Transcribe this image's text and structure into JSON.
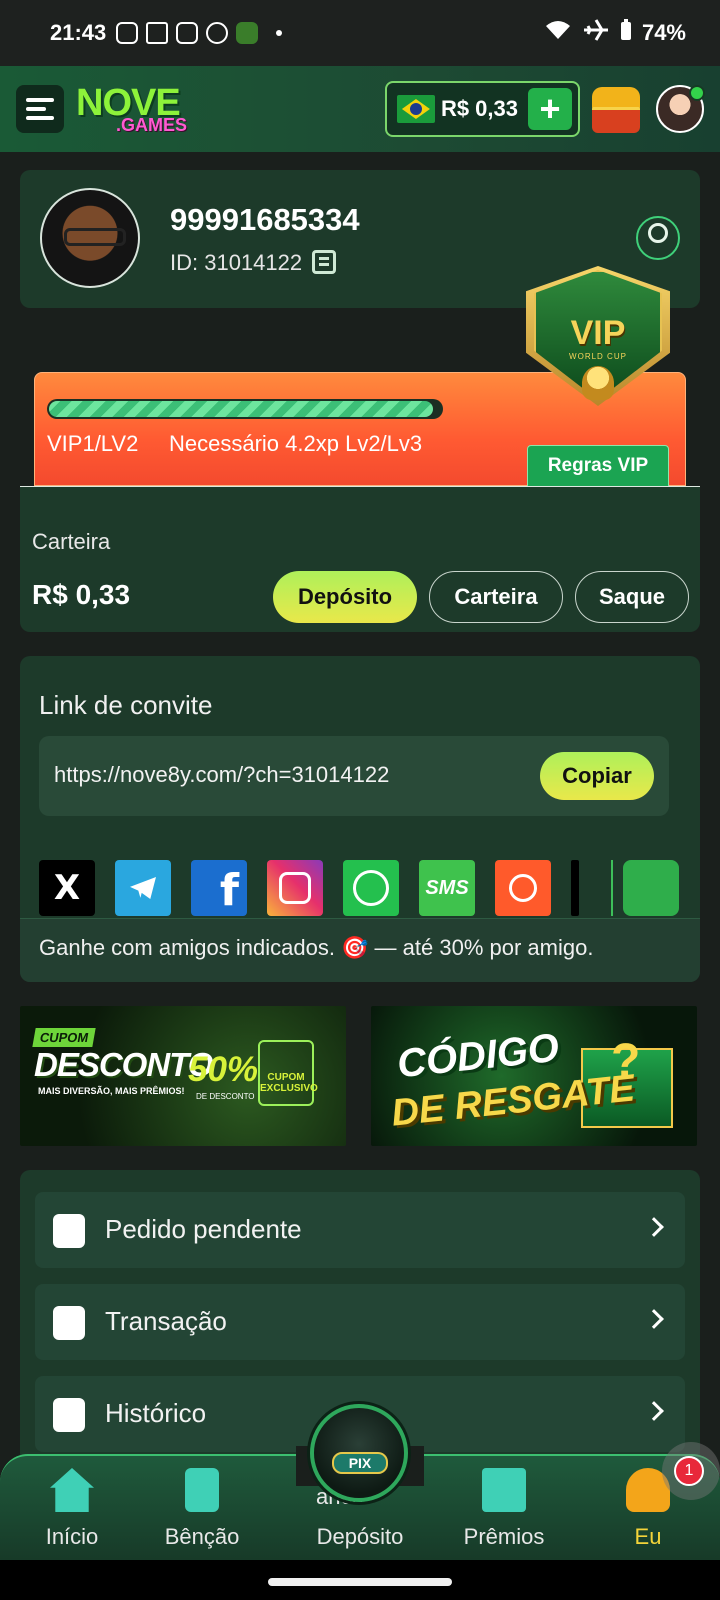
{
  "status_bar": {
    "time": "21:43",
    "battery": "74%"
  },
  "header": {
    "logo_top": "NOVE",
    "logo_bottom": ".GAMES",
    "balance": "R$ 0,33",
    "add_label": "+"
  },
  "profile": {
    "username": "99991685334",
    "id_text": "ID: 31014122"
  },
  "vip": {
    "badge": "VIP",
    "badge_sub": "WORLD CUP",
    "progress": 0.98,
    "level": "VIP1/LV2",
    "need": "Necessário 4.2xp Lv2/Lv3",
    "rules_label": "Regras VIP"
  },
  "wallet": {
    "title": "Carteira",
    "amount": "R$ 0,33",
    "deposit_label": "Depósito",
    "wallet_label": "Carteira",
    "withdraw_label": "Saque"
  },
  "invite": {
    "title": "Link de convite",
    "url": "https://nove8y.com/?ch=31014122",
    "copy_label": "Copiar",
    "share": [
      "x",
      "telegram",
      "facebook",
      "instagram",
      "whatsapp",
      "sms",
      "kwai",
      "more",
      "apps"
    ],
    "sms_label": "SMS",
    "x_label": "X",
    "fb_label": "f",
    "footer": "Ganhe com amigos indicados. 🎯 — até 30% por amigo."
  },
  "banners": {
    "b1_tag": "CUPOM",
    "b1_main": "DESCONTO",
    "b1_sub": "MAIS DIVERSÃO, MAIS PRÊMIOS!",
    "b1_pct": "50%",
    "b1_pct_sub": "DE DESCONTO",
    "b1_coupon": "CUPOM EXCLUSIVO",
    "b2_main1": "CÓDIGO",
    "b2_main2": "DE RESGATE",
    "b2_q": "?"
  },
  "menu": [
    {
      "label": "Pedido pendente"
    },
    {
      "label": "Transação"
    },
    {
      "label": "Histórico"
    }
  ],
  "bottom_nav": {
    "home": "Início",
    "bencao": "Bênção",
    "deposit": "Depósito",
    "prizes": "Prêmios",
    "me": "Eu",
    "pix": "PIX",
    "partial": "ança"
  },
  "notification_count": "1"
}
